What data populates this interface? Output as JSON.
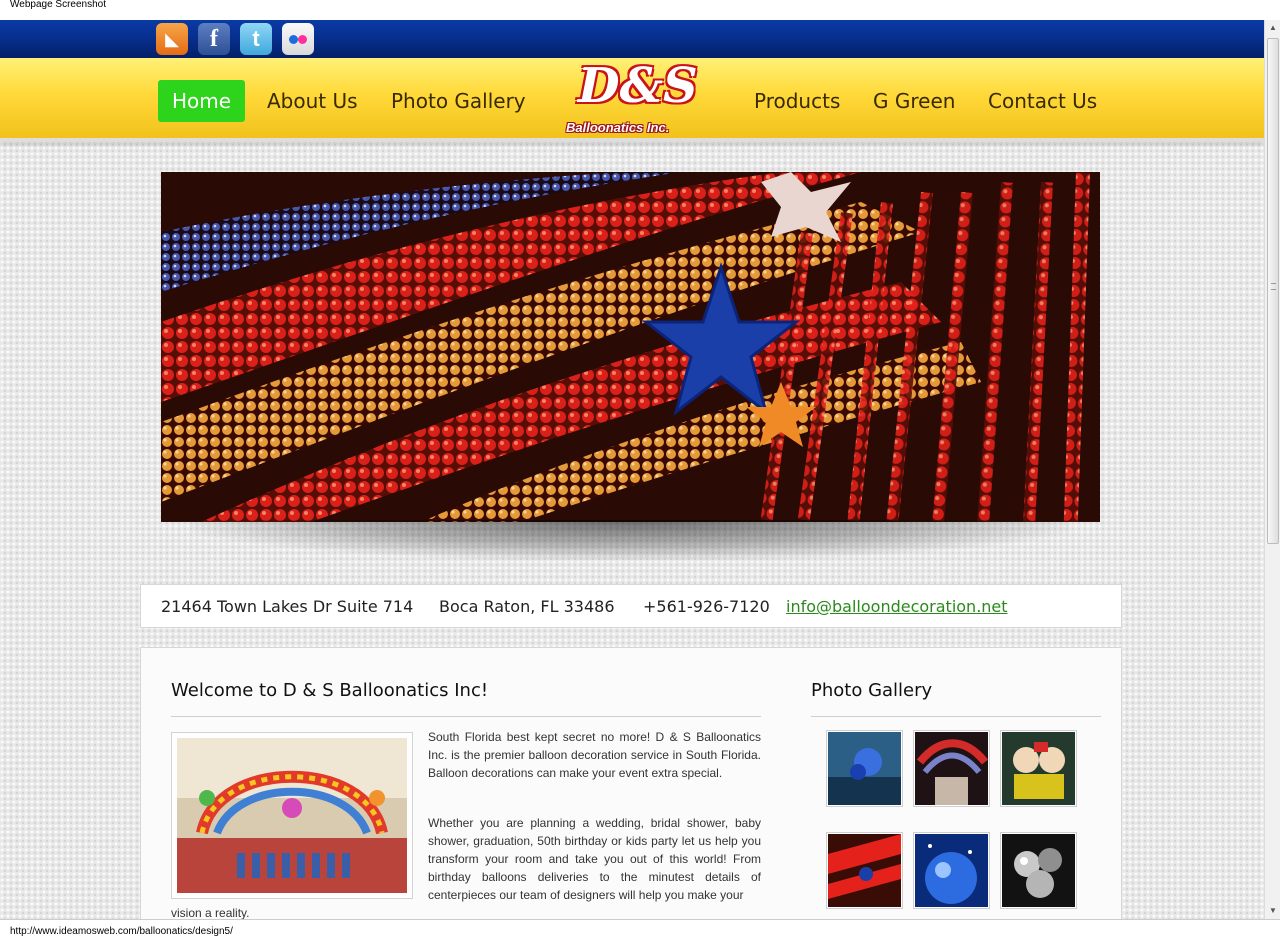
{
  "window": {
    "title": "Webpage Screenshot"
  },
  "status_bar": {
    "url": "http://www.ideamosweb.com/balloonatics/design5/"
  },
  "social": [
    {
      "name": "rss-icon",
      "glyph": "◣"
    },
    {
      "name": "facebook-icon",
      "glyph": "f"
    },
    {
      "name": "twitter-icon",
      "glyph": "t"
    },
    {
      "name": "flickr-icon",
      "glyph": ""
    }
  ],
  "nav": {
    "items": [
      {
        "label": "Home",
        "active": true
      },
      {
        "label": "About Us"
      },
      {
        "label": "Photo Gallery"
      },
      {
        "label": "Products"
      },
      {
        "label": "G Green"
      },
      {
        "label": "Contact Us"
      }
    ],
    "logo": {
      "mark": "D&S",
      "company": "Balloonatics Inc."
    }
  },
  "contact": {
    "address": "21464 Town Lakes Dr Suite 714",
    "city": "Boca Raton, FL 33486",
    "phone": "+561-926-7120",
    "email": "info@balloondecoration.net"
  },
  "welcome": {
    "title": "Welcome to D & S Balloonatics Inc!",
    "para1": "South Florida best kept secret no more! D & S Balloonatics Inc. is the premier balloon decoration service in South Florida. Balloon decorations can make your event extra special.",
    "para2": "Whether you are planning a wedding, bridal shower, baby shower, graduation, 50th birthday or kids party let us help you transform your room and take you out of this world! From birthday balloons deliveries to the minutest details of centerpieces our team of designers will help you make your",
    "para2_tail": "vision a reality."
  },
  "gallery": {
    "title": "Photo Gallery"
  },
  "colors": {
    "top_bar": "#062d89",
    "nav_yellow": "#ffd93a",
    "active_nav": "#2ed41c",
    "email_link": "#2a8a1c",
    "logo_red": "#c9131b"
  }
}
